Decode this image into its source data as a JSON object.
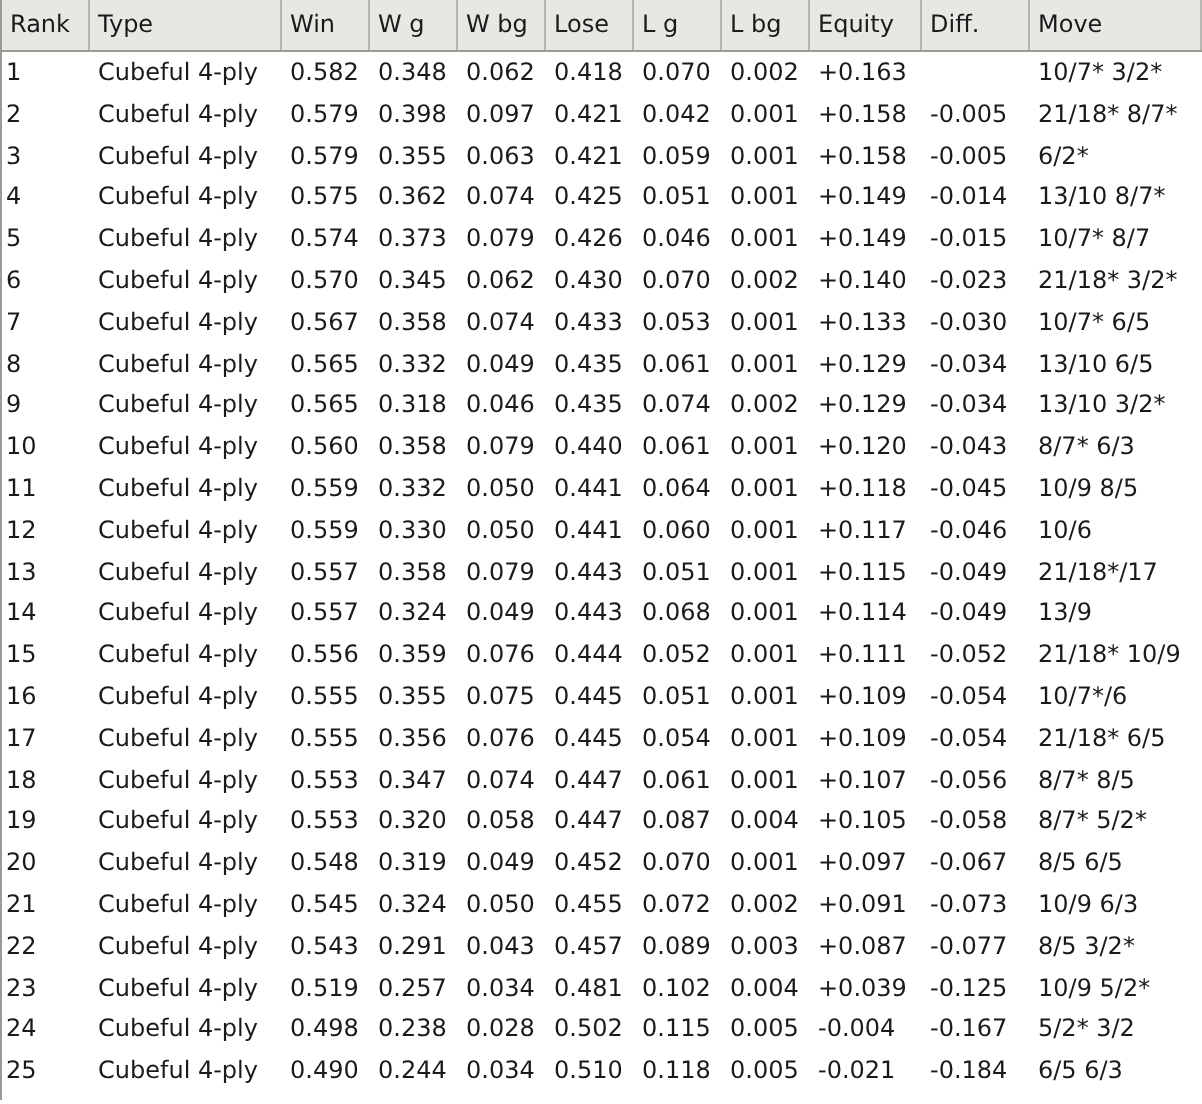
{
  "table": {
    "columns": [
      "Rank",
      "Type",
      "Win",
      "W g",
      "W bg",
      "Lose",
      "L g",
      "L bg",
      "Equity",
      "Diff.",
      "Move"
    ],
    "rows": [
      [
        "1",
        "Cubeful 4-ply",
        "0.582",
        "0.348",
        "0.062",
        "0.418",
        "0.070",
        "0.002",
        "+0.163",
        "",
        "10/7* 3/2*"
      ],
      [
        "2",
        "Cubeful 4-ply",
        "0.579",
        "0.398",
        "0.097",
        "0.421",
        "0.042",
        "0.001",
        "+0.158",
        "-0.005",
        "21/18* 8/7*"
      ],
      [
        "3",
        "Cubeful 4-ply",
        "0.579",
        "0.355",
        "0.063",
        "0.421",
        "0.059",
        "0.001",
        "+0.158",
        "-0.005",
        "6/2*"
      ],
      [
        "4",
        "Cubeful 4-ply",
        "0.575",
        "0.362",
        "0.074",
        "0.425",
        "0.051",
        "0.001",
        "+0.149",
        "-0.014",
        "13/10 8/7*"
      ],
      [
        "5",
        "Cubeful 4-ply",
        "0.574",
        "0.373",
        "0.079",
        "0.426",
        "0.046",
        "0.001",
        "+0.149",
        "-0.015",
        "10/7* 8/7"
      ],
      [
        "6",
        "Cubeful 4-ply",
        "0.570",
        "0.345",
        "0.062",
        "0.430",
        "0.070",
        "0.002",
        "+0.140",
        "-0.023",
        "21/18* 3/2*"
      ],
      [
        "7",
        "Cubeful 4-ply",
        "0.567",
        "0.358",
        "0.074",
        "0.433",
        "0.053",
        "0.001",
        "+0.133",
        "-0.030",
        "10/7* 6/5"
      ],
      [
        "8",
        "Cubeful 4-ply",
        "0.565",
        "0.332",
        "0.049",
        "0.435",
        "0.061",
        "0.001",
        "+0.129",
        "-0.034",
        "13/10 6/5"
      ],
      [
        "9",
        "Cubeful 4-ply",
        "0.565",
        "0.318",
        "0.046",
        "0.435",
        "0.074",
        "0.002",
        "+0.129",
        "-0.034",
        "13/10 3/2*"
      ],
      [
        "10",
        "Cubeful 4-ply",
        "0.560",
        "0.358",
        "0.079",
        "0.440",
        "0.061",
        "0.001",
        "+0.120",
        "-0.043",
        "8/7* 6/3"
      ],
      [
        "11",
        "Cubeful 4-ply",
        "0.559",
        "0.332",
        "0.050",
        "0.441",
        "0.064",
        "0.001",
        "+0.118",
        "-0.045",
        "10/9 8/5"
      ],
      [
        "12",
        "Cubeful 4-ply",
        "0.559",
        "0.330",
        "0.050",
        "0.441",
        "0.060",
        "0.001",
        "+0.117",
        "-0.046",
        "10/6"
      ],
      [
        "13",
        "Cubeful 4-ply",
        "0.557",
        "0.358",
        "0.079",
        "0.443",
        "0.051",
        "0.001",
        "+0.115",
        "-0.049",
        "21/18*/17"
      ],
      [
        "14",
        "Cubeful 4-ply",
        "0.557",
        "0.324",
        "0.049",
        "0.443",
        "0.068",
        "0.001",
        "+0.114",
        "-0.049",
        "13/9"
      ],
      [
        "15",
        "Cubeful 4-ply",
        "0.556",
        "0.359",
        "0.076",
        "0.444",
        "0.052",
        "0.001",
        "+0.111",
        "-0.052",
        "21/18* 10/9"
      ],
      [
        "16",
        "Cubeful 4-ply",
        "0.555",
        "0.355",
        "0.075",
        "0.445",
        "0.051",
        "0.001",
        "+0.109",
        "-0.054",
        "10/7*/6"
      ],
      [
        "17",
        "Cubeful 4-ply",
        "0.555",
        "0.356",
        "0.076",
        "0.445",
        "0.054",
        "0.001",
        "+0.109",
        "-0.054",
        "21/18* 6/5"
      ],
      [
        "18",
        "Cubeful 4-ply",
        "0.553",
        "0.347",
        "0.074",
        "0.447",
        "0.061",
        "0.001",
        "+0.107",
        "-0.056",
        "8/7* 8/5"
      ],
      [
        "19",
        "Cubeful 4-ply",
        "0.553",
        "0.320",
        "0.058",
        "0.447",
        "0.087",
        "0.004",
        "+0.105",
        "-0.058",
        "8/7* 5/2*"
      ],
      [
        "20",
        "Cubeful 4-ply",
        "0.548",
        "0.319",
        "0.049",
        "0.452",
        "0.070",
        "0.001",
        "+0.097",
        "-0.067",
        "8/5 6/5"
      ],
      [
        "21",
        "Cubeful 4-ply",
        "0.545",
        "0.324",
        "0.050",
        "0.455",
        "0.072",
        "0.002",
        "+0.091",
        "-0.073",
        "10/9 6/3"
      ],
      [
        "22",
        "Cubeful 4-ply",
        "0.543",
        "0.291",
        "0.043",
        "0.457",
        "0.089",
        "0.003",
        "+0.087",
        "-0.077",
        "8/5 3/2*"
      ],
      [
        "23",
        "Cubeful 4-ply",
        "0.519",
        "0.257",
        "0.034",
        "0.481",
        "0.102",
        "0.004",
        "+0.039",
        "-0.125",
        "10/9 5/2*"
      ],
      [
        "24",
        "Cubeful 4-ply",
        "0.498",
        "0.238",
        "0.028",
        "0.502",
        "0.115",
        "0.005",
        "-0.004",
        "-0.167",
        "5/2* 3/2"
      ],
      [
        "25",
        "Cubeful 4-ply",
        "0.490",
        "0.244",
        "0.034",
        "0.510",
        "0.118",
        "0.005",
        "-0.021",
        "-0.184",
        "6/5 6/3"
      ]
    ]
  }
}
